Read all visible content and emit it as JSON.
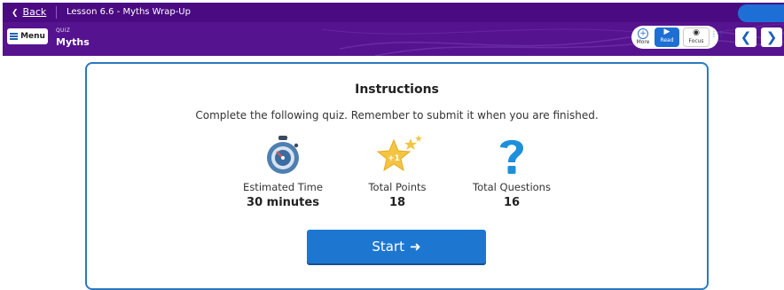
{
  "topbar": {
    "back_label": "Back",
    "lesson_title": "Lesson 6.6 - Myths Wrap-Up"
  },
  "navbar": {
    "menu_label": "Menu",
    "quiz_type": "QUIZ",
    "quiz_title": "Myths",
    "tools": {
      "more_label": "More",
      "read_label": "Read",
      "focus_label": "Focus"
    }
  },
  "instructions": {
    "title": "Instructions",
    "description": "Complete the following quiz. Remember to submit it when you are finished.",
    "stats": [
      {
        "icon": "stopwatch-icon",
        "label": "Estimated Time",
        "value": "30 minutes"
      },
      {
        "icon": "star-icon",
        "badge": "+1",
        "label": "Total Points",
        "value": "18"
      },
      {
        "icon": "question-mark-icon",
        "label": "Total Questions",
        "value": "16"
      }
    ],
    "start_label": "Start"
  },
  "colors": {
    "topbar": "#4a0b82",
    "navbar": "#56138f",
    "accent": "#1d77d1",
    "card_border": "#2b78c2",
    "star": "#f4c542"
  }
}
